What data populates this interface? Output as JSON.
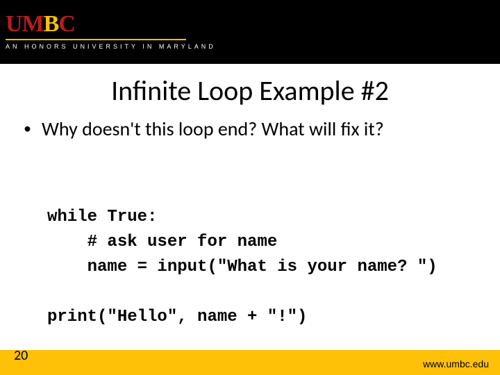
{
  "brand": {
    "u1": "U",
    "m": "M",
    "b": "B",
    "c": "C",
    "tagline": "AN HONORS UNIVERSITY IN MARYLAND"
  },
  "title": "Infinite Loop Example #2",
  "bullet": {
    "marker": "•",
    "text": "Why doesn't this loop end?  What will fix it?"
  },
  "code": {
    "line1": "while True:",
    "line2": "    # ask user for name",
    "line3": "    name = input(\"What is your name? \")",
    "blank": "",
    "line4": "print(\"Hello\", name + \"!\")"
  },
  "footer": {
    "page": "20",
    "url": "www.umbc.edu"
  }
}
